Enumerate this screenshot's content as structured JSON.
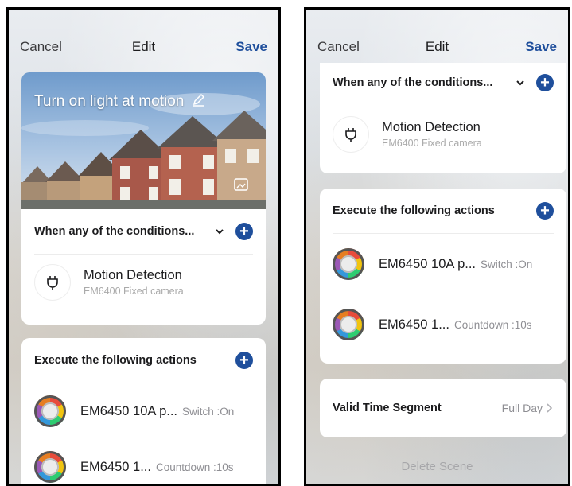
{
  "left": {
    "nav": {
      "cancel": "Cancel",
      "title": "Edit",
      "save": "Save"
    },
    "scene_title": "Turn on light at motion",
    "conditions_header": "When any of the conditions...",
    "condition": {
      "name": "Motion Detection",
      "sub": "EM6400 Fixed camera"
    },
    "actions_header": "Execute the following actions",
    "actions": [
      {
        "name": "EM6450 10A p...",
        "value": "Switch :On"
      },
      {
        "name": "EM6450 1...",
        "value": "Countdown :10s"
      }
    ]
  },
  "right": {
    "nav": {
      "cancel": "Cancel",
      "title": "Edit",
      "save": "Save"
    },
    "conditions_header": "When any of the conditions...",
    "condition": {
      "name": "Motion Detection",
      "sub": "EM6400 Fixed camera"
    },
    "actions_header": "Execute the following actions",
    "actions": [
      {
        "name": "EM6450 10A p...",
        "value": "Switch :On"
      },
      {
        "name": "EM6450 1...",
        "value": "Countdown :10s"
      }
    ],
    "valid_time": {
      "label": "Valid Time Segment",
      "value": "Full Day"
    },
    "delete_label": "Delete Scene"
  },
  "colors": {
    "accent": "#1f4f9c",
    "sub_text": "#aaaaaa"
  },
  "icons": [
    "chevron-down-icon",
    "plus-icon",
    "plug-icon",
    "edit-pencil-icon",
    "image-icon",
    "chevron-right-icon",
    "energy-meter-icon"
  ]
}
